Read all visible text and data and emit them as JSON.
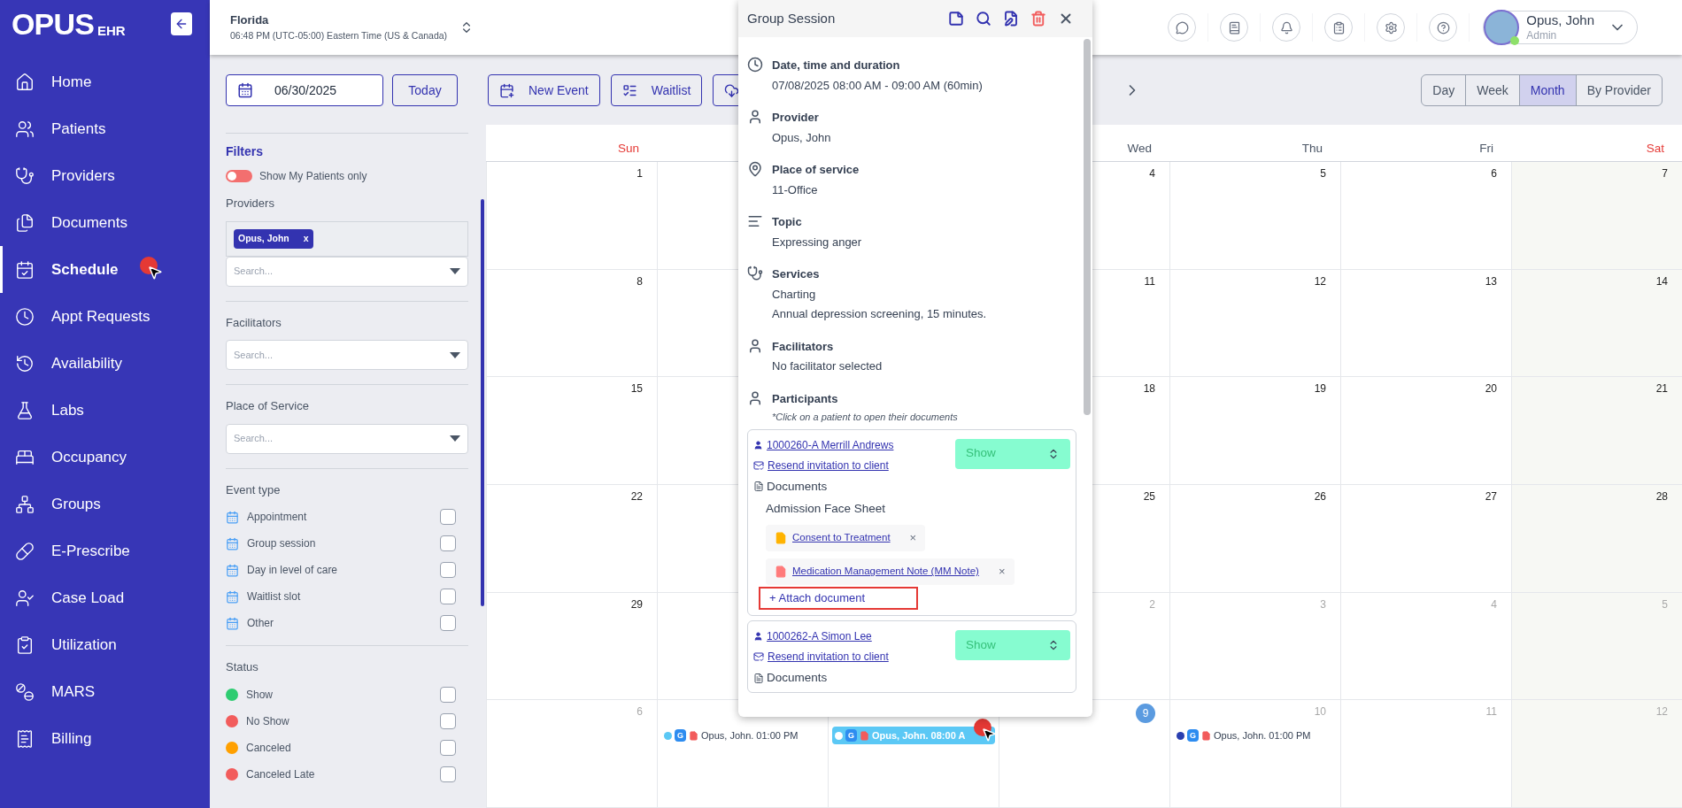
{
  "sidebar": {
    "logo": {
      "main": "OPUS",
      "suffix": "EHR"
    },
    "items": [
      {
        "label": "Home",
        "selected": false
      },
      {
        "label": "Patients",
        "selected": false
      },
      {
        "label": "Providers",
        "selected": false
      },
      {
        "label": "Documents",
        "selected": false
      },
      {
        "label": "Schedule",
        "selected": true
      },
      {
        "label": "Appt Requests",
        "selected": false
      },
      {
        "label": "Availability",
        "selected": false
      },
      {
        "label": "Labs",
        "selected": false
      },
      {
        "label": "Occupancy",
        "selected": false
      },
      {
        "label": "Groups",
        "selected": false
      },
      {
        "label": "E-Prescribe",
        "selected": false
      },
      {
        "label": "Case Load",
        "selected": false
      },
      {
        "label": "Utilization",
        "selected": false
      },
      {
        "label": "MARS",
        "selected": false
      },
      {
        "label": "Billing",
        "selected": false
      }
    ]
  },
  "topbar": {
    "location": "Florida",
    "time": "06:48 PM (UTC-05:00) Eastern Time (US & Canada)",
    "user": {
      "name": "Opus, John",
      "role": "Admin",
      "online": true
    }
  },
  "filters": {
    "date": "06/30/2025",
    "today": "Today",
    "title": "Filters",
    "my_patients": {
      "label": "Show My Patients only",
      "on": false
    },
    "providers": {
      "label": "Providers",
      "chips": [
        {
          "label": "Opus, John",
          "remove": "x"
        }
      ],
      "placeholder": "Search..."
    },
    "facilitators": {
      "label": "Facilitators",
      "placeholder": "Search..."
    },
    "place_of_service": {
      "label": "Place of Service",
      "placeholder": "Search..."
    },
    "event_types": {
      "label": "Event type",
      "items": [
        {
          "label": "Appointment",
          "checked": false
        },
        {
          "label": "Group session",
          "checked": false
        },
        {
          "label": "Day in level of care",
          "checked": false
        },
        {
          "label": "Waitlist slot",
          "checked": false
        },
        {
          "label": "Other",
          "checked": false
        }
      ]
    },
    "statuses": {
      "label": "Status",
      "items": [
        {
          "label": "Show",
          "color": "#2ecc71",
          "checked": false
        },
        {
          "label": "No Show",
          "color": "#f25c5c",
          "checked": false
        },
        {
          "label": "Canceled",
          "color": "#ffa000",
          "checked": false
        },
        {
          "label": "Canceled Late",
          "color": "#f25c5c",
          "checked": false
        }
      ]
    }
  },
  "toolbar": {
    "buttons": [
      "New Event",
      "Waitlist"
    ],
    "views": [
      {
        "label": "Day",
        "selected": false
      },
      {
        "label": "Week",
        "selected": false
      },
      {
        "label": "Month",
        "selected": true
      },
      {
        "label": "By Provider",
        "selected": false
      }
    ]
  },
  "calendar": {
    "headers": {
      "sun": "Sun",
      "wed": "Wed",
      "thu": "Thu",
      "fri": "Fri",
      "sat": "Sat"
    },
    "weeks": [
      {
        "sun": {
          "day": "1",
          "outside": false
        },
        "wed": {
          "day": "4",
          "outside": false
        },
        "thu": {
          "day": "5",
          "outside": false
        },
        "fri": {
          "day": "6",
          "outside": false
        },
        "sat": {
          "day": "7",
          "outside": false
        }
      },
      {
        "sun": {
          "day": "8",
          "outside": false
        },
        "wed": {
          "day": "11",
          "outside": false
        },
        "thu": {
          "day": "12",
          "outside": false
        },
        "fri": {
          "day": "13",
          "outside": false
        },
        "sat": {
          "day": "14",
          "outside": false
        }
      },
      {
        "sun": {
          "day": "15",
          "outside": false
        },
        "wed": {
          "day": "18",
          "outside": false
        },
        "thu": {
          "day": "19",
          "outside": false
        },
        "fri": {
          "day": "20",
          "outside": false
        },
        "sat": {
          "day": "21",
          "outside": false
        }
      },
      {
        "sun": {
          "day": "22",
          "outside": false
        },
        "wed": {
          "day": "25",
          "outside": false
        },
        "thu": {
          "day": "26",
          "outside": false
        },
        "fri": {
          "day": "27",
          "outside": false
        },
        "sat": {
          "day": "28",
          "outside": false
        }
      },
      {
        "sun": {
          "day": "29",
          "outside": false
        },
        "wed": {
          "day": "2",
          "outside": true
        },
        "thu": {
          "day": "3",
          "outside": true
        },
        "fri": {
          "day": "4",
          "outside": true
        },
        "sat": {
          "day": "5",
          "outside": true
        }
      },
      {
        "sun": {
          "day": "6",
          "outside": true
        },
        "mon": {
          "events": [
            {
              "text": "Opus, John. 01:00 PM",
              "badge": "G",
              "color": "#5bc8f5",
              "selected": false
            }
          ]
        },
        "tue": {
          "events": [
            {
              "text": "Opus, John. 08:00 A",
              "badge": "G",
              "color": "#ffffff",
              "selected": true
            }
          ]
        },
        "wed": {
          "day": "9",
          "outside": false,
          "today": true
        },
        "thu": {
          "day": "10",
          "outside": true,
          "events": [
            {
              "text": "Opus, John. 01:00 PM",
              "badge": "G",
              "color": "#2a3fb0",
              "selected": false
            }
          ]
        },
        "fri": {
          "day": "11",
          "outside": true
        },
        "sat": {
          "day": "12",
          "outside": true
        }
      }
    ]
  },
  "popup": {
    "title": "Group Session",
    "fields": [
      {
        "label": "Date, time and duration",
        "values": [
          "07/08/2025 08:00 AM - 09:00 AM (60min)"
        ]
      },
      {
        "label": "Provider",
        "values": [
          "Opus, John"
        ]
      },
      {
        "label": "Place of service",
        "values": [
          "11-Office"
        ]
      },
      {
        "label": "Topic",
        "values": [
          "Expressing anger"
        ]
      },
      {
        "label": "Services",
        "values": [
          "Charting",
          "Annual depression screening, 15 minutes."
        ]
      },
      {
        "label": "Facilitators",
        "values": [
          "No facilitator selected"
        ]
      }
    ],
    "participants": {
      "label": "Participants",
      "note": "*Click on a patient to open their documents",
      "items": [
        {
          "patient": "1000260-A Merrill Andrews",
          "resend": "Resend invitation to client",
          "status": "Show",
          "documents_label": "Documents",
          "documents": [
            {
              "name": "Admission Face Sheet",
              "kind": "plain"
            },
            {
              "name": "Consent to Treatment",
              "kind": "attached",
              "color": "#ffb300",
              "remove": "×"
            },
            {
              "name": "Medication Management Note (MM Note)",
              "kind": "attached",
              "color": "#ff7b7b",
              "remove": "×"
            }
          ],
          "attach": {
            "label": "+ Attach document",
            "highlighted": true
          }
        },
        {
          "patient": "1000262-A Simon Lee",
          "resend": "Resend invitation to client",
          "status": "Show",
          "documents_label": "Documents"
        }
      ]
    }
  }
}
